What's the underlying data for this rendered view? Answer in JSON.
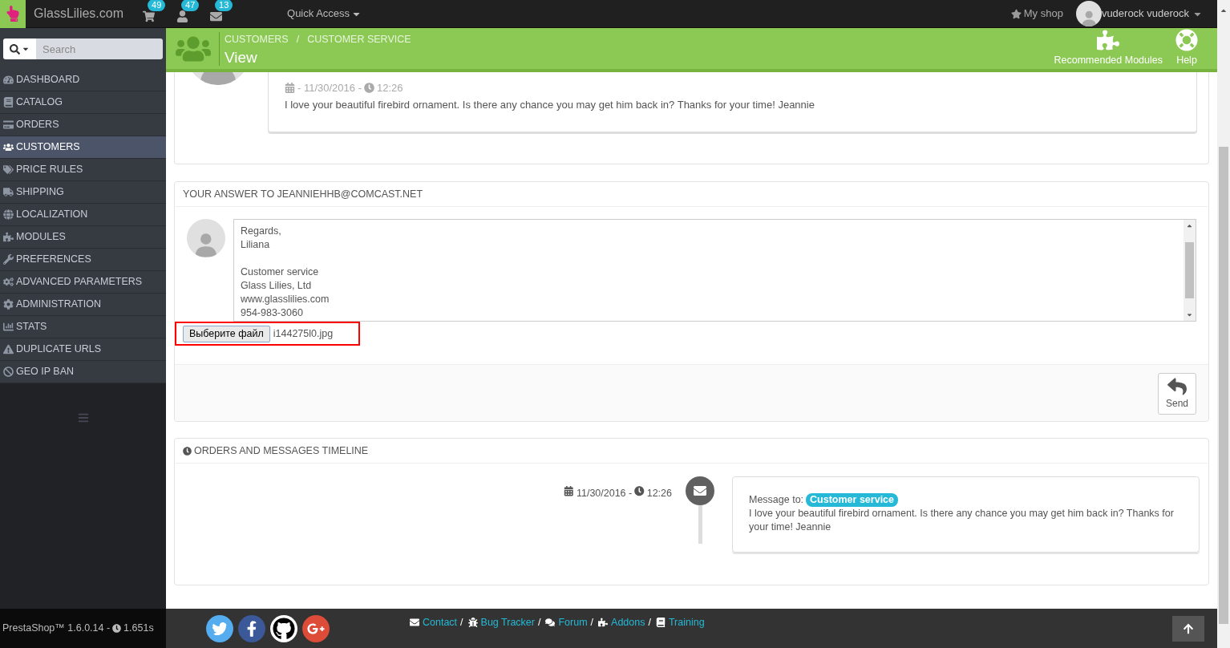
{
  "topbar": {
    "shop_name": "GlassLilies.com",
    "badges": [
      {
        "count": "49"
      },
      {
        "count": "47"
      },
      {
        "count": "13"
      }
    ],
    "quick_access": "Quick Access",
    "my_shop": "My shop",
    "user": "vuderock vuderock"
  },
  "sidebar": {
    "search": {
      "placeholder": "Search"
    },
    "items": [
      {
        "label": "DASHBOARD",
        "selected": false
      },
      {
        "label": "CATALOG",
        "selected": false
      },
      {
        "label": "ORDERS",
        "selected": false
      },
      {
        "label": "CUSTOMERS",
        "selected": true
      },
      {
        "label": "PRICE RULES",
        "selected": false
      },
      {
        "label": "SHIPPING",
        "selected": false
      },
      {
        "label": "LOCALIZATION",
        "selected": false
      },
      {
        "label": "MODULES",
        "selected": false
      },
      {
        "label": "PREFERENCES",
        "selected": false
      },
      {
        "label": "ADVANCED PARAMETERS",
        "selected": false
      },
      {
        "label": "ADMINISTRATION",
        "selected": false
      },
      {
        "label": "STATS",
        "selected": false
      },
      {
        "label": "DUPLICATE URLS",
        "selected": false
      },
      {
        "label": "GEO IP BAN",
        "selected": false
      }
    ]
  },
  "page_header": {
    "breadcrumbs": [
      "CUSTOMERS",
      "CUSTOMER SERVICE"
    ],
    "separator": "/",
    "title": "View",
    "toolbar": [
      {
        "label": "Recommended Modules"
      },
      {
        "label": "Help"
      }
    ]
  },
  "message": {
    "date": "- 11/30/2016 -",
    "time": "12:26",
    "text": "I love your beautiful firebird ornament. Is there any chance you may get him back in? Thanks for your time! Jeannie"
  },
  "answer": {
    "heading": "YOUR ANSWER TO JEANNIEHHB@COMCAST.NET",
    "paragraphs": [
      [
        "Regards,",
        "Liliana"
      ],
      [
        "Customer service",
        "Glass Lilies, Ltd",
        "www.glasslilies.com",
        "954-983-3060"
      ]
    ],
    "file_button": "Выберите файл",
    "file_name": "i144275l0.jpg",
    "send": "Send"
  },
  "timeline": {
    "heading": "ORDERS AND MESSAGES TIMELINE",
    "items": [
      {
        "date": "11/30/2016 -",
        "time": "12:26",
        "prefix": "Message to:",
        "tag": "Customer service",
        "text": "I love your beautiful firebird ornament. Is there any chance you may get him back in? Thanks for your time! Jeannie"
      }
    ]
  },
  "footer": {
    "version": "PrestaShop™ 1.6.0.14 -",
    "load_time": "1.651s",
    "links": [
      {
        "label": "Contact",
        "trailing": "/"
      },
      {
        "label": "Bug Tracker",
        "trailing": "/"
      },
      {
        "label": "Forum",
        "trailing": "/"
      },
      {
        "label": "Addons",
        "trailing": "/"
      },
      {
        "label": "Training"
      }
    ]
  }
}
